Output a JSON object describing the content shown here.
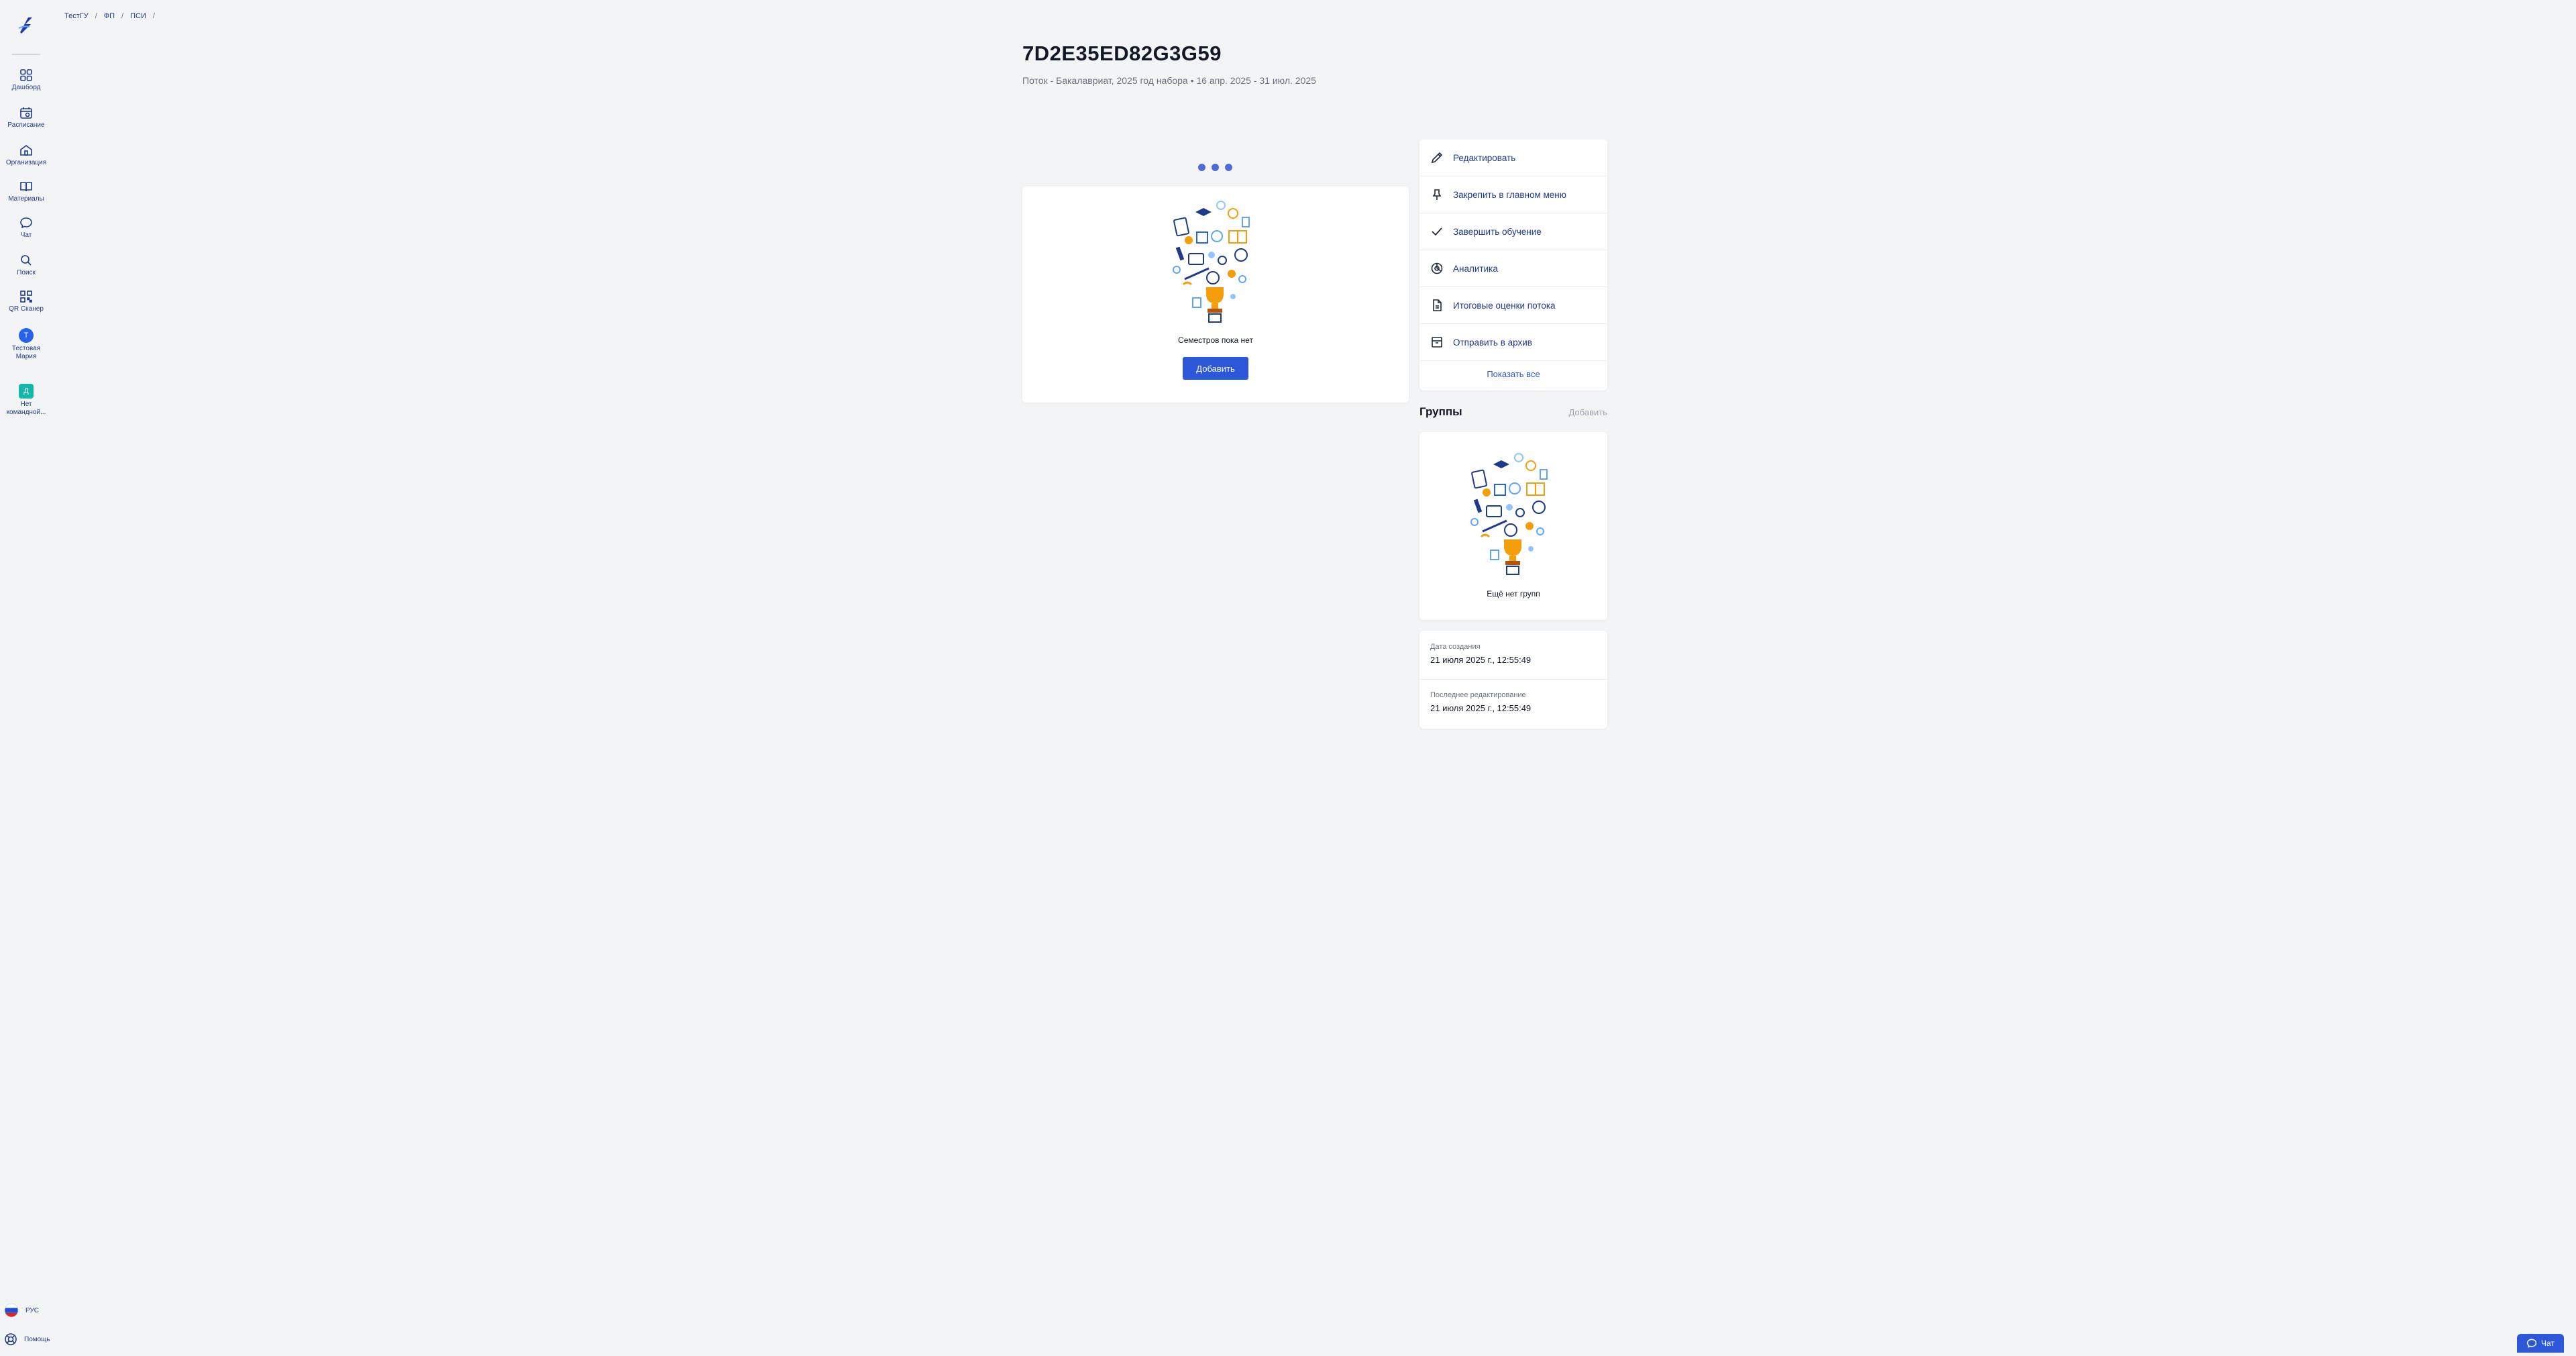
{
  "sidebar": {
    "items": [
      {
        "label": "Дашборд",
        "icon": "dashboard-icon"
      },
      {
        "label": "Расписание",
        "icon": "calendar-icon"
      },
      {
        "label": "Организация",
        "icon": "building-icon"
      },
      {
        "label": "Материалы",
        "icon": "book-icon"
      },
      {
        "label": "Чат",
        "icon": "chat-icon"
      },
      {
        "label": "Поиск",
        "icon": "search-icon"
      },
      {
        "label": "QR Сканер",
        "icon": "qr-icon"
      }
    ],
    "user": {
      "initial": "Т",
      "label": "Тестовая Мария"
    },
    "team": {
      "initial": "Д",
      "label": "Нет командной..."
    },
    "language": "РУС",
    "help": "Помощь"
  },
  "breadcrumb": [
    "ТестГУ",
    "ФП",
    "ПСИ"
  ],
  "page": {
    "title": "7D2E35ED82G3G59",
    "subtitle": "Поток - Бакалавриат, 2025 год набора • 16 апр. 2025 - 31 июл. 2025"
  },
  "semesters": {
    "empty_text": "Семестров пока нет",
    "add_label": "Добавить"
  },
  "actions": {
    "items": [
      {
        "label": "Редактировать",
        "icon": "pencil-icon"
      },
      {
        "label": "Закрепить в главном меню",
        "icon": "pin-icon"
      },
      {
        "label": "Завершить обучение",
        "icon": "check-icon"
      },
      {
        "label": "Аналитика",
        "icon": "analytics-icon"
      },
      {
        "label": "Итоговые оценки потока",
        "icon": "document-icon"
      },
      {
        "label": "Отправить в архив",
        "icon": "archive-icon"
      }
    ],
    "show_all": "Показать все"
  },
  "groups": {
    "title": "Группы",
    "add_label": "Добавить",
    "empty_text": "Ещё нет групп"
  },
  "meta": {
    "created_label": "Дата создания",
    "created_value": "21 июля 2025 г., 12:55:49",
    "edited_label": "Последнее редактирование",
    "edited_value": "21 июля 2025 г., 12:55:49"
  },
  "chat_button": "Чат",
  "colors": {
    "accent": "#2c57d9",
    "nav_text": "#1f3a8a",
    "background": "#f3f4f6"
  }
}
